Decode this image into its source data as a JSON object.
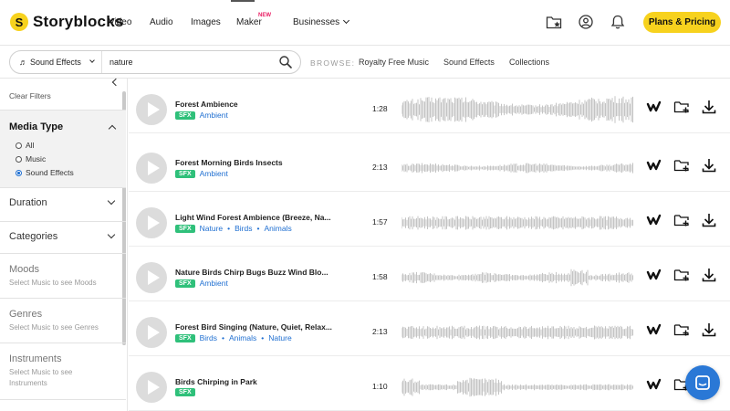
{
  "brand": {
    "name": "Storyblocks",
    "mark": "S"
  },
  "nav": {
    "video": "Video",
    "audio": "Audio",
    "images": "Images",
    "maker": "Maker",
    "maker_badge": "NEW",
    "businesses": "Businesses",
    "plans_button": "Plans & Pricing"
  },
  "search": {
    "type": "Sound Effects",
    "query": "nature"
  },
  "browse": {
    "label": "BROWSE:",
    "links": [
      "Royalty Free Music",
      "Sound Effects",
      "Collections"
    ]
  },
  "sidebar": {
    "clear_filters": "Clear Filters",
    "media_type": {
      "title": "Media Type",
      "options": [
        {
          "label": "All",
          "selected": false
        },
        {
          "label": "Music",
          "selected": false
        },
        {
          "label": "Sound Effects",
          "selected": true
        }
      ]
    },
    "duration": "Duration",
    "categories": "Categories",
    "moods": {
      "title": "Moods",
      "hint": "Select Music to see Moods"
    },
    "genres": {
      "title": "Genres",
      "hint": "Select Music to see Genres"
    },
    "instruments": {
      "title": "Instruments",
      "hint": "Select Music to see Instruments"
    }
  },
  "results": [
    {
      "title": "Forest Ambience",
      "badge": "SFX",
      "tags": [
        "Ambient"
      ],
      "duration": "1:28"
    },
    {
      "title": "Forest Morning Birds Insects",
      "badge": "SFX",
      "tags": [
        "Ambient"
      ],
      "duration": "2:13"
    },
    {
      "title": "Light Wind Forest Ambience (Breeze, Na...",
      "badge": "SFX",
      "tags": [
        "Nature",
        "Birds",
        "Animals"
      ],
      "duration": "1:57"
    },
    {
      "title": "Nature Birds Chirp Bugs Buzz Wind Blo...",
      "badge": "SFX",
      "tags": [
        "Ambient"
      ],
      "duration": "1:58"
    },
    {
      "title": "Forest Bird Singing (Nature, Quiet, Relax...",
      "badge": "SFX",
      "tags": [
        "Birds",
        "Animals",
        "Nature"
      ],
      "duration": "2:13"
    },
    {
      "title": "Birds Chirping in Park",
      "badge": "SFX",
      "tags": [],
      "duration": "1:10"
    }
  ],
  "colors": {
    "accent_yellow": "#f7d21e",
    "link_blue": "#1f6fd1",
    "sfx_green": "#2fc07a",
    "waveform_gray": "#c4c4c4"
  }
}
